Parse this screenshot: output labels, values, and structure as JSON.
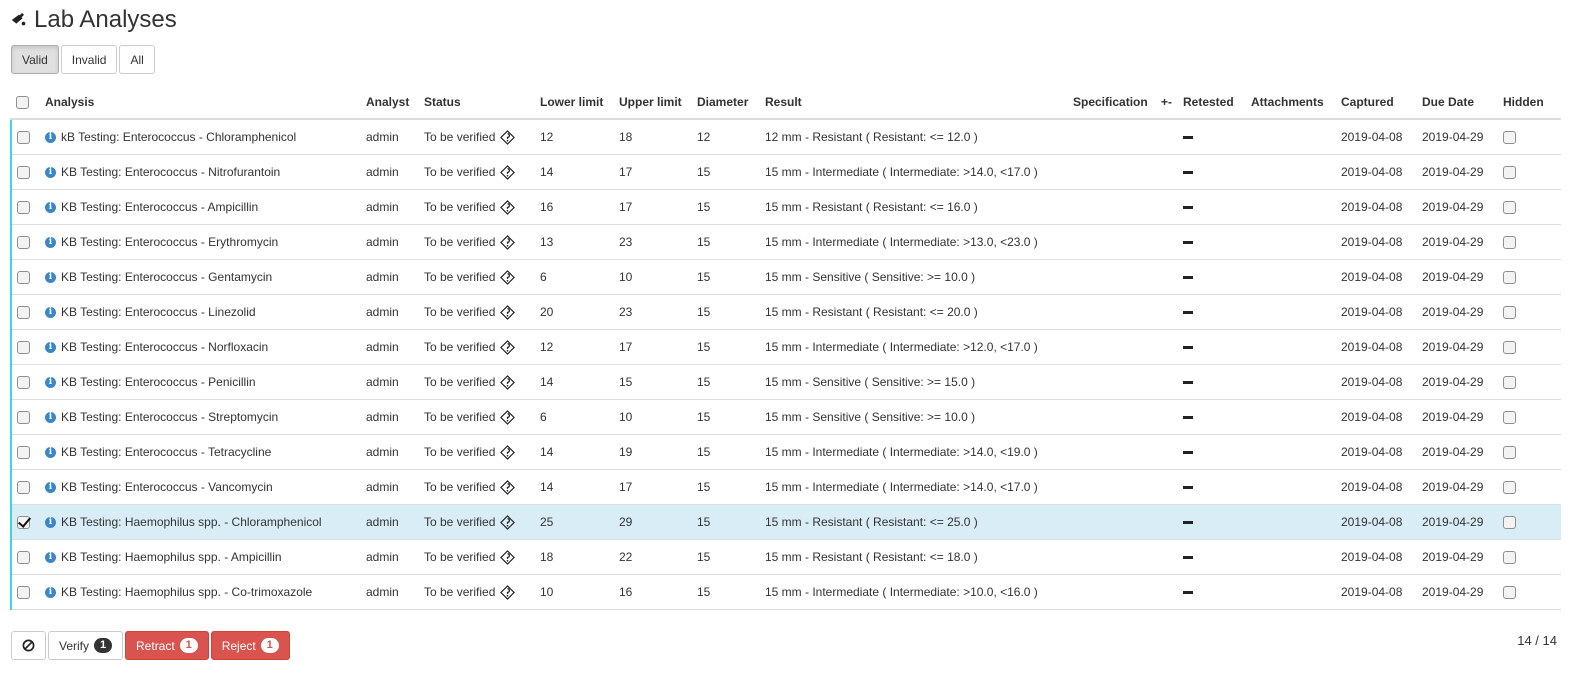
{
  "title": "Lab Analyses",
  "filters": [
    "Valid",
    "Invalid",
    "All"
  ],
  "columns": {
    "analysis": "Analysis",
    "analyst": "Analyst",
    "status": "Status",
    "lower": "Lower limit",
    "upper": "Upper limit",
    "diameter": "Diameter",
    "result": "Result",
    "specification": "Specification",
    "plusminus": "+-",
    "retested": "Retested",
    "attachments": "Attachments",
    "captured": "Captured",
    "due": "Due Date",
    "hidden": "Hidden"
  },
  "rows": [
    {
      "analysis": "kB Testing: Enterococcus - Chloramphenicol",
      "analyst": "admin",
      "status": "To be verified",
      "lower": "12",
      "upper": "18",
      "diameter": "12",
      "result": "12 mm - Resistant ( Resistant: <= 12.0 )",
      "captured": "2019-04-08",
      "due": "2019-04-29",
      "checked": false
    },
    {
      "analysis": "KB Testing: Enterococcus - Nitrofurantoin",
      "analyst": "admin",
      "status": "To be verified",
      "lower": "14",
      "upper": "17",
      "diameter": "15",
      "result": "15 mm - Intermediate ( Intermediate: >14.0, <17.0 )",
      "captured": "2019-04-08",
      "due": "2019-04-29",
      "checked": false
    },
    {
      "analysis": "KB Testing: Enterococcus - Ampicillin",
      "analyst": "admin",
      "status": "To be verified",
      "lower": "16",
      "upper": "17",
      "diameter": "15",
      "result": "15 mm - Resistant ( Resistant: <= 16.0 )",
      "captured": "2019-04-08",
      "due": "2019-04-29",
      "checked": false
    },
    {
      "analysis": "KB Testing: Enterococcus - Erythromycin",
      "analyst": "admin",
      "status": "To be verified",
      "lower": "13",
      "upper": "23",
      "diameter": "15",
      "result": "15 mm - Intermediate ( Intermediate: >13.0, <23.0 )",
      "captured": "2019-04-08",
      "due": "2019-04-29",
      "checked": false
    },
    {
      "analysis": "KB Testing: Enterococcus - Gentamycin",
      "analyst": "admin",
      "status": "To be verified",
      "lower": "6",
      "upper": "10",
      "diameter": "15",
      "result": "15 mm - Sensitive ( Sensitive: >= 10.0 )",
      "captured": "2019-04-08",
      "due": "2019-04-29",
      "checked": false
    },
    {
      "analysis": "KB Testing: Enterococcus - Linezolid",
      "analyst": "admin",
      "status": "To be verified",
      "lower": "20",
      "upper": "23",
      "diameter": "15",
      "result": "15 mm - Resistant ( Resistant: <= 20.0 )",
      "captured": "2019-04-08",
      "due": "2019-04-29",
      "checked": false
    },
    {
      "analysis": "KB Testing: Enterococcus - Norfloxacin",
      "analyst": "admin",
      "status": "To be verified",
      "lower": "12",
      "upper": "17",
      "diameter": "15",
      "result": "15 mm - Intermediate ( Intermediate: >12.0, <17.0 )",
      "captured": "2019-04-08",
      "due": "2019-04-29",
      "checked": false
    },
    {
      "analysis": "KB Testing: Enterococcus - Penicillin",
      "analyst": "admin",
      "status": "To be verified",
      "lower": "14",
      "upper": "15",
      "diameter": "15",
      "result": "15 mm - Sensitive ( Sensitive: >= 15.0 )",
      "captured": "2019-04-08",
      "due": "2019-04-29",
      "checked": false
    },
    {
      "analysis": "KB Testing: Enterococcus - Streptomycin",
      "analyst": "admin",
      "status": "To be verified",
      "lower": "6",
      "upper": "10",
      "diameter": "15",
      "result": "15 mm - Sensitive ( Sensitive: >= 10.0 )",
      "captured": "2019-04-08",
      "due": "2019-04-29",
      "checked": false
    },
    {
      "analysis": "KB Testing: Enterococcus - Tetracycline",
      "analyst": "admin",
      "status": "To be verified",
      "lower": "14",
      "upper": "19",
      "diameter": "15",
      "result": "15 mm - Intermediate ( Intermediate: >14.0, <19.0 )",
      "captured": "2019-04-08",
      "due": "2019-04-29",
      "checked": false
    },
    {
      "analysis": "KB Testing: Enterococcus - Vancomycin",
      "analyst": "admin",
      "status": "To be verified",
      "lower": "14",
      "upper": "17",
      "diameter": "15",
      "result": "15 mm - Intermediate ( Intermediate: >14.0, <17.0 )",
      "captured": "2019-04-08",
      "due": "2019-04-29",
      "checked": false
    },
    {
      "analysis": "KB Testing: Haemophilus spp. - Chloramphenicol",
      "analyst": "admin",
      "status": "To be verified",
      "lower": "25",
      "upper": "29",
      "diameter": "15",
      "result": "15 mm - Resistant ( Resistant: <= 25.0 )",
      "captured": "2019-04-08",
      "due": "2019-04-29",
      "checked": true
    },
    {
      "analysis": "KB Testing: Haemophilus spp. - Ampicillin",
      "analyst": "admin",
      "status": "To be verified",
      "lower": "18",
      "upper": "22",
      "diameter": "15",
      "result": "15 mm - Resistant ( Resistant: <= 18.0 )",
      "captured": "2019-04-08",
      "due": "2019-04-29",
      "checked": false
    },
    {
      "analysis": "KB Testing: Haemophilus spp. - Co-trimoxazole",
      "analyst": "admin",
      "status": "To be verified",
      "lower": "10",
      "upper": "16",
      "diameter": "15",
      "result": "15 mm - Intermediate ( Intermediate: >10.0, <16.0 )",
      "captured": "2019-04-08",
      "due": "2019-04-29",
      "checked": false
    }
  ],
  "actions": {
    "verify_label": "Verify",
    "verify_count": "1",
    "retract_label": "Retract",
    "retract_count": "1",
    "reject_label": "Reject",
    "reject_count": "1"
  },
  "pager": "14 / 14",
  "colors": {
    "accent": "#3fd3e6",
    "danger": "#d9534f",
    "selected_row": "#d9edf7",
    "info": "#3a87c8"
  }
}
